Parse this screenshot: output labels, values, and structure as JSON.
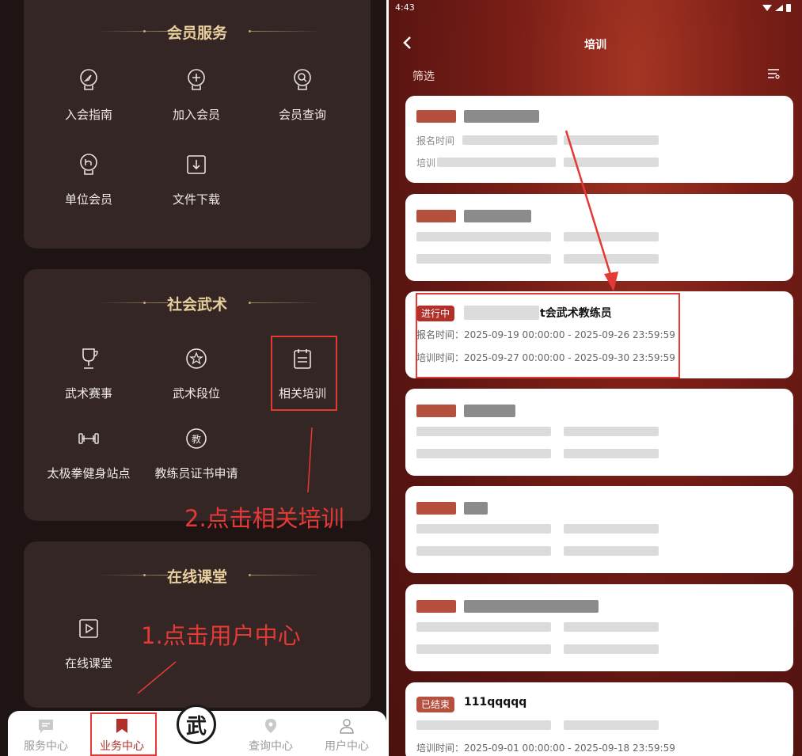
{
  "left": {
    "sections": [
      {
        "title": "会员服务",
        "items": [
          {
            "label": "入会指南",
            "icon": "guide-icon"
          },
          {
            "label": "加入会员",
            "icon": "add-member-icon"
          },
          {
            "label": "会员查询",
            "icon": "search-member-icon"
          },
          {
            "label": "单位会员",
            "icon": "unit-member-icon"
          },
          {
            "label": "文件下载",
            "icon": "download-icon"
          }
        ]
      },
      {
        "title": "社会武术",
        "items": [
          {
            "label": "武术赛事",
            "icon": "trophy-icon"
          },
          {
            "label": "武术段位",
            "icon": "star-badge-icon"
          },
          {
            "label": "相关培训",
            "icon": "calendar-list-icon"
          },
          {
            "label": "太极拳健身站点",
            "icon": "dumbbell-icon"
          },
          {
            "label": "教练员证书申请",
            "icon": "coach-cert-icon"
          }
        ]
      },
      {
        "title": "在线课堂",
        "items": [
          {
            "label": "在线课堂",
            "icon": "play-icon"
          }
        ]
      }
    ],
    "annotations": {
      "step1": "1.点击用户中心",
      "step2": "2.点击相关培训"
    },
    "coach_cert_glyph": "教",
    "nav": [
      {
        "label": "服务中心",
        "icon": "message-icon",
        "active": false
      },
      {
        "label": "业务中心",
        "icon": "bookmark-icon",
        "active": true
      },
      {
        "label": "武",
        "icon": "logo-icon",
        "active": false
      },
      {
        "label": "查询中心",
        "icon": "location-pin-icon",
        "active": false
      },
      {
        "label": "用户中心",
        "icon": "user-icon",
        "active": false
      }
    ]
  },
  "right": {
    "status_time": "4:43",
    "title": "培训",
    "filter_label": "筛选",
    "highlight_card": {
      "tag": "进行中",
      "name": "t会武术教练员",
      "signup_time": "报名时间：2025-09-19 00:00:00 - 2025-09-26 23:59:59",
      "training_time": "培训时间：2025-09-27 00:00:00 - 2025-09-30 23:59:59"
    },
    "last_card": {
      "tag": "已结束",
      "name": "111qqqqq",
      "training_time": "培训时间：2025-09-01 00:00:00 - 2025-09-18 23:59:59"
    },
    "card1_signup_label": "报名时间",
    "card1_train_label": "培训"
  },
  "colors": {
    "accent_red": "#b0302a",
    "gold_title": "#e9cf9e",
    "annotation_red": "#e53935"
  }
}
